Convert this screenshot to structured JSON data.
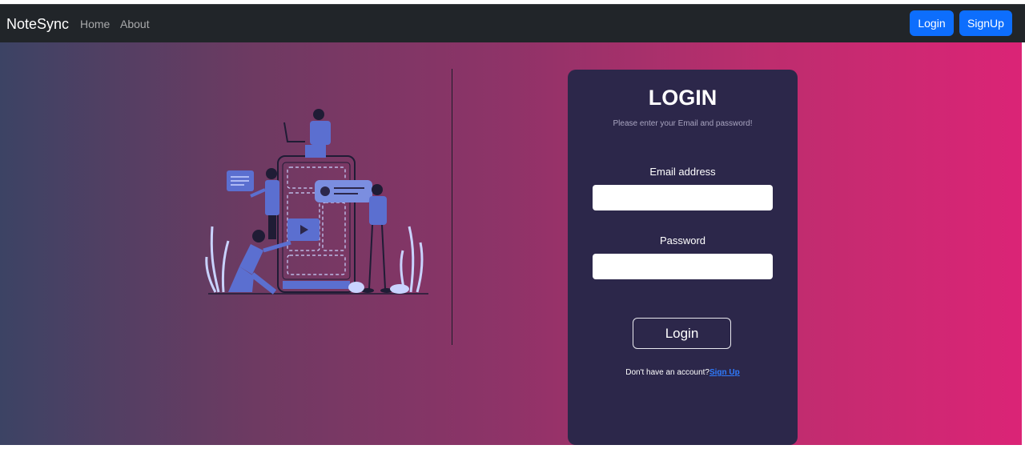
{
  "navbar": {
    "brand": "NoteSync",
    "links": [
      "Home",
      "About"
    ],
    "buttons": {
      "login": "Login",
      "signup": "SignUp"
    }
  },
  "login_card": {
    "title": "LOGIN",
    "subtitle": "Please enter your Email and password!",
    "email_label": "Email address",
    "email_value": "",
    "password_label": "Password",
    "password_value": "",
    "submit_label": "Login",
    "signup_prompt": "Don't have an account?",
    "signup_link": "Sign Up"
  },
  "illustration": {
    "icon": "team-building-app-illustration",
    "colors": {
      "figure": "#5b6fd0",
      "outline": "#1f1c35",
      "plant": "#c9d3ff"
    }
  },
  "colors": {
    "navbar": "#212529",
    "primary_button": "#0d6efd",
    "card": "#2c274a",
    "gradient_start": "#3c4364",
    "gradient_end": "#db2476"
  }
}
